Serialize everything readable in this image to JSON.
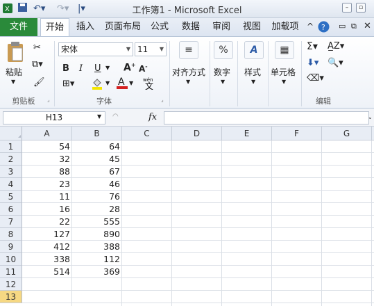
{
  "window": {
    "title": "工作簿1 - Microsoft Excel"
  },
  "ribbon": {
    "file_tab": "文件",
    "tabs": [
      "开始",
      "插入",
      "页面布局",
      "公式",
      "数据",
      "审阅",
      "视图",
      "加载项"
    ],
    "active_tab": "开始",
    "clipboard": {
      "paste": "粘贴",
      "group": "剪贴板"
    },
    "font": {
      "name": "宋体",
      "size": "11",
      "group": "字体"
    },
    "alignment": {
      "label": "对齐方式"
    },
    "number": {
      "label": "数字",
      "icon": "%"
    },
    "styles": {
      "label": "样式"
    },
    "cells": {
      "label": "单元格"
    },
    "editing": {
      "group": "编辑"
    }
  },
  "formula_bar": {
    "name_box": "H13",
    "fx": "fx",
    "value": ""
  },
  "grid": {
    "columns": [
      "A",
      "B",
      "C",
      "D",
      "E",
      "F",
      "G"
    ],
    "rows": [
      "1",
      "2",
      "3",
      "4",
      "5",
      "6",
      "7",
      "8",
      "9",
      "10",
      "11",
      "12",
      "13"
    ],
    "selected_row": "13",
    "col_a": [
      "54",
      "32",
      "88",
      "23",
      "11",
      "16",
      "22",
      "127",
      "412",
      "338",
      "514",
      "",
      ""
    ],
    "col_b": [
      "64",
      "45",
      "67",
      "46",
      "76",
      "28",
      "555",
      "890",
      "388",
      "112",
      "369",
      "",
      ""
    ]
  }
}
